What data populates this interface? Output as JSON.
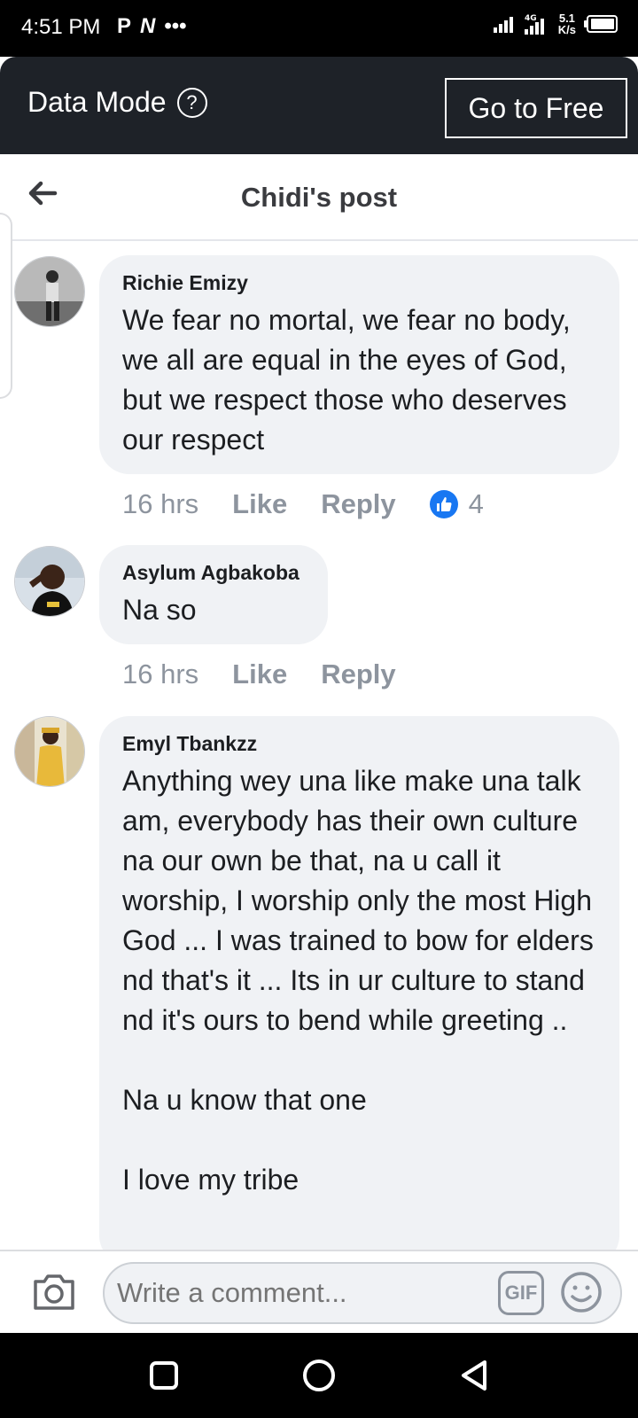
{
  "status_bar": {
    "time": "4:51 PM",
    "left_icons": [
      "p-icon",
      "n-icon",
      "more-dots-icon"
    ],
    "network_type": "4G",
    "speed_value": "5.1",
    "speed_unit": "K/s"
  },
  "data_mode": {
    "title": "Data Mode",
    "help_icon": "?",
    "button_label": "Go to Free"
  },
  "header": {
    "title": "Chidi's post"
  },
  "comments": [
    {
      "author": "Richie Emizy",
      "text": "We fear no mortal, we fear no body, we all are equal in the eyes of God, but we respect those who deserves our respect",
      "time": "16 hrs",
      "like_label": "Like",
      "reply_label": "Reply",
      "reaction_count": "4"
    },
    {
      "author": "Asylum Agbakoba",
      "text": "Na so",
      "time": "16 hrs",
      "like_label": "Like",
      "reply_label": "Reply"
    },
    {
      "author": "Emyl Tbankzz",
      "text": "Anything wey una like make una talk am, everybody has their own culture na our own be that, na u call it worship, I worship only the most High God ... I was trained to bow for elders nd that's it ... Its in ur culture to stand nd it's ours to bend while greeting ..\n\nNa u know that one\n\nI love my tribe"
    }
  ],
  "composer": {
    "placeholder": "Write a comment...",
    "gif_label": "GIF"
  },
  "colors": {
    "accent": "#1877f2",
    "bubble": "#f0f2f5",
    "data_bar": "#1e2228",
    "meta_text": "#8d949e"
  }
}
